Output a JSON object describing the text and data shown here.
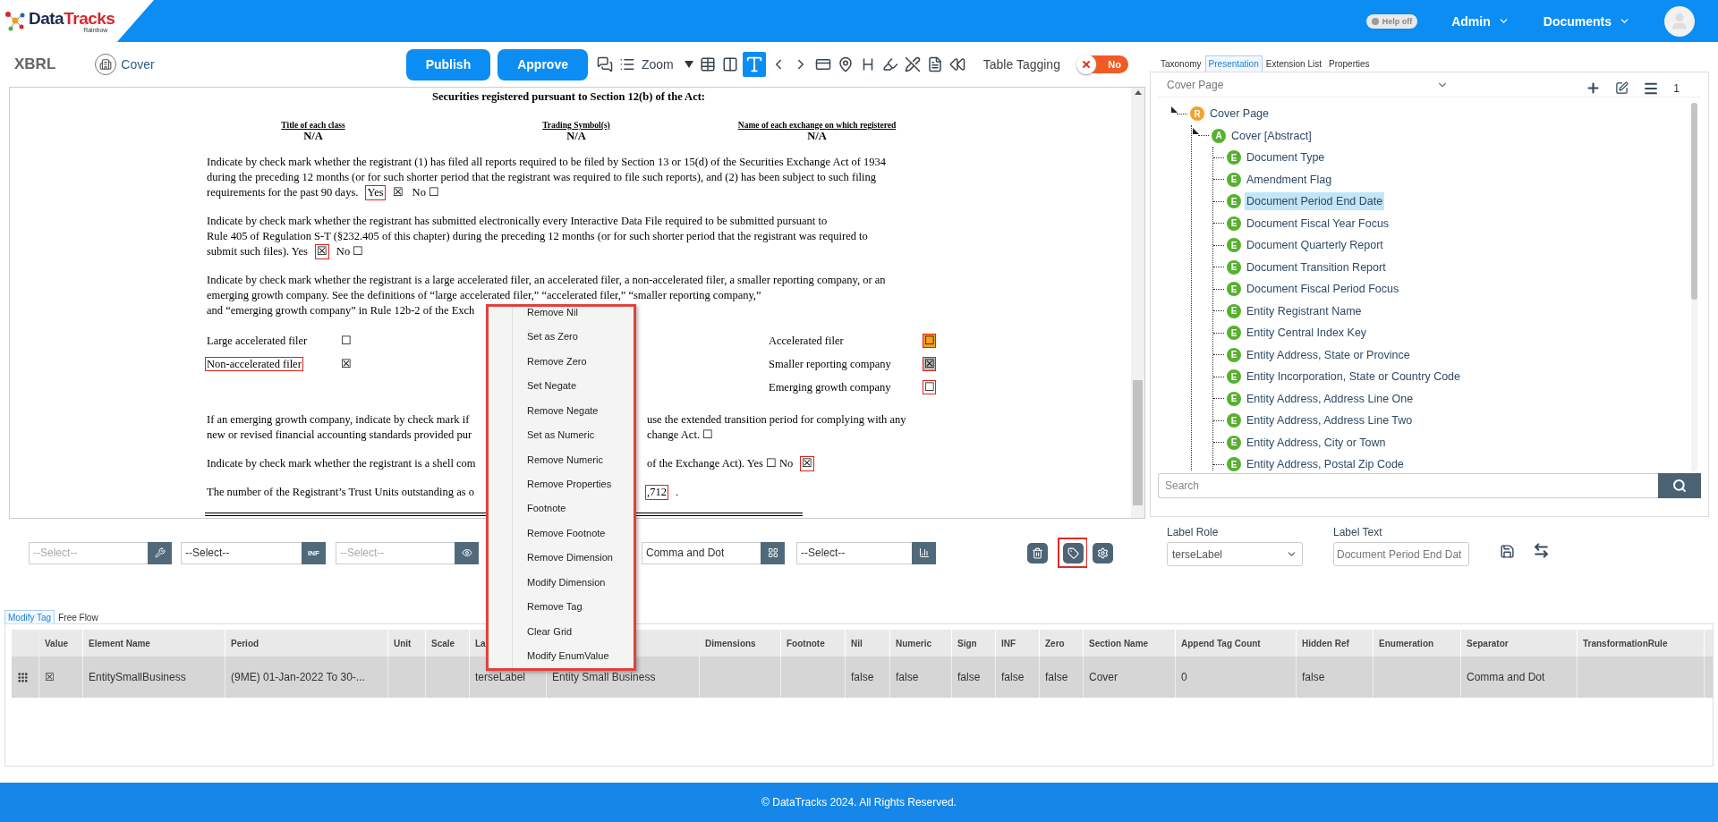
{
  "header": {
    "logo": {
      "brand": "Data",
      "brand_accent": "Tracks",
      "tagline": "Rainbow"
    },
    "help_toggle": {
      "label": "Help off",
      "on": false
    },
    "menus": [
      {
        "label": "Admin"
      },
      {
        "label": "Documents"
      }
    ]
  },
  "toolbar": {
    "title": "XBRL",
    "section": "Cover",
    "buttons": [
      "Publish",
      "Approve"
    ],
    "tools": [
      {
        "kind": "comments",
        "selected": false
      },
      {
        "kind": "list",
        "selected": false
      },
      {
        "kind": "zoom",
        "label": "Zoom",
        "selected": false
      },
      {
        "kind": "table",
        "selected": false
      },
      {
        "kind": "columns",
        "selected": false
      },
      {
        "kind": "text-cursor",
        "selected": true
      },
      {
        "kind": "prev",
        "selected": false
      },
      {
        "kind": "next",
        "selected": false
      },
      {
        "kind": "card",
        "selected": false
      },
      {
        "kind": "pin",
        "selected": false
      },
      {
        "kind": "heading",
        "selected": false
      },
      {
        "kind": "highlight",
        "selected": false
      },
      {
        "kind": "unhighlight",
        "selected": false
      },
      {
        "kind": "document",
        "selected": false
      },
      {
        "kind": "rewind",
        "selected": false
      }
    ],
    "table_tagging": {
      "label": "Table Tagging",
      "on": false,
      "state_label": "No"
    }
  },
  "document": {
    "heading": "Securities registered pursuant to Section 12(b) of the Act:",
    "securities_table": [
      {
        "header": "Title of each class",
        "value": "N/A"
      },
      {
        "header": "Trading Symbol(s)",
        "value": "N/A"
      },
      {
        "header": "Name of each exchange on which registered",
        "value": "N/A"
      }
    ],
    "paragraphs_top": [
      {
        "lines": [
          {
            "left": [
              {
                "text": "Indicate by check mark whether the registrant (1) has filed all reports required to be filed by Section 13 or 15(d) of the Securities Exchange Act of 1934",
                "tagged": false
              }
            ]
          },
          {
            "left": [
              {
                "text": "during the preceding 12 months (or for such shorter period that the registrant was required to file such reports), and (2) has been subject to such filing",
                "tagged": false
              }
            ]
          },
          {
            "left": [
              {
                "text": "requirements for the past 90 days.",
                "tagged": false
              },
              {
                "text": "Yes",
                "tagged": true
              },
              {
                "text": "☒",
                "tagged": false
              },
              {
                "text": "No ☐",
                "tagged": false
              }
            ]
          }
        ]
      },
      {
        "lines": [
          {
            "left": [
              {
                "text": "Indicate by check mark whether the registrant has submitted electronically every Interactive Data File required to be submitted pursuant to",
                "tagged": false
              }
            ]
          },
          {
            "left": [
              {
                "text": "Rule 405 of Regulation S-T (§232.405 of this chapter) during the preceding 12 months (or for such shorter period that the registrant was required to",
                "tagged": false
              }
            ]
          },
          {
            "left": [
              {
                "text": "submit such files).   Yes",
                "tagged": false
              },
              {
                "text": "☒",
                "tagged": true
              },
              {
                "text": "No ☐",
                "tagged": false
              }
            ]
          }
        ]
      },
      {
        "lines": [
          {
            "left": [
              {
                "text": "Indicate by check mark whether the registrant is a large accelerated filer, an accelerated filer, a non-accelerated filer, a smaller reporting company, or an",
                "tagged": false
              }
            ]
          },
          {
            "left": [
              {
                "text": "emerging growth company. See the definitions of “large accelerated filer,” “accelerated filer,” “smaller reporting company,”",
                "tagged": false
              }
            ]
          },
          {
            "left": [
              {
                "text": "and “emerging growth company” in Rule 12b-2 of the Exch",
                "tagged": false
              }
            ]
          }
        ]
      }
    ],
    "filer_left": [
      {
        "label": "Large accelerated filer",
        "label_tagged": false,
        "box": "☐",
        "box_tagged": false
      },
      {
        "label": "Non-accelerated filer",
        "label_tagged": true,
        "box": "☒",
        "box_tagged": false
      }
    ],
    "filer_right": [
      {
        "label": "Accelerated filer",
        "label_tagged": false,
        "box": "☐",
        "box_tagged": true,
        "color": "#f7a01c"
      },
      {
        "label": "Smaller reporting company",
        "label_tagged": false,
        "box": "☒",
        "box_tagged": true,
        "color": "#b9b9b9"
      },
      {
        "label": "Emerging growth company",
        "label_tagged": false,
        "box": "☐",
        "box_tagged": true
      }
    ],
    "paragraphs_bottom": [
      {
        "lines": [
          {
            "left": [
              {
                "text": "If an emerging growth company, indicate by check mark if",
                "tagged": false
              }
            ],
            "right": [
              {
                "text": "use the extended transition period for complying with any",
                "tagged": false
              }
            ]
          },
          {
            "left": [
              {
                "text": "new or revised financial accounting standards provided pur",
                "tagged": false
              }
            ],
            "right": [
              {
                "text": "change Act. ☐",
                "tagged": false
              }
            ]
          }
        ]
      },
      {
        "lines": [
          {
            "left": [
              {
                "text": "Indicate by check mark whether the registrant is a shell com",
                "tagged": false
              }
            ],
            "right": [
              {
                "text": "of the Exchange Act).   Yes ☐   No",
                "tagged": false
              },
              {
                "text": "☒",
                "tagged": true
              }
            ]
          }
        ]
      },
      {
        "lines": [
          {
            "left": [
              {
                "text": "The number of the Registrant’s Trust Units outstanding as o",
                "tagged": false
              }
            ],
            "right": [
              {
                "text": ",712",
                "tagged": true
              },
              {
                "text": ".",
                "tagged": false
              }
            ]
          }
        ]
      }
    ]
  },
  "context_menu": [
    "Remove Nil",
    "Set as Zero",
    "Remove Zero",
    "Set Negate",
    "Remove Negate",
    "Set as Numeric",
    "Remove Numeric",
    "Remove Properties",
    "Footnote",
    "Remove Footnote",
    "Remove Dimension",
    "Modify Dimension",
    "Remove Tag",
    "Clear Grid",
    "Modify EnumValue"
  ],
  "tag_controls": [
    {
      "value": "--Select--",
      "disabled": true
    },
    {
      "value": "--Select--",
      "disabled": false,
      "button_label": "INF"
    },
    {
      "value": "--Select--",
      "disabled": true
    },
    {
      "value": "Comma and Dot",
      "disabled": false
    },
    {
      "value": "--Select--",
      "disabled": false
    }
  ],
  "tag_actions": [
    {
      "selected": false
    },
    {
      "selected": true
    },
    {
      "selected": false
    }
  ],
  "side_panel": {
    "tabs": [
      {
        "label": "Taxonomy",
        "selected": false
      },
      {
        "label": "Presentation",
        "selected": true
      },
      {
        "label": "Extension List",
        "selected": false
      },
      {
        "label": "Properties",
        "selected": false
      }
    ],
    "role_select": "Cover Page",
    "count": "1",
    "tree": [
      {
        "label": "Cover Page",
        "badge": "R",
        "color": "#f5a02a",
        "expanded": true,
        "selected": false,
        "children": [
          {
            "label": "Cover [Abstract]",
            "badge": "A",
            "color": "#58b030",
            "expanded": true,
            "selected": false,
            "children": [
              {
                "label": "Document Type",
                "badge": "E",
                "color": "#58b030",
                "selected": false
              },
              {
                "label": "Amendment Flag",
                "badge": "E",
                "color": "#58b030",
                "selected": false
              },
              {
                "label": "Document Period End Date",
                "badge": "E",
                "color": "#58b030",
                "selected": true
              },
              {
                "label": "Document Fiscal Year Focus",
                "badge": "E",
                "color": "#58b030",
                "selected": false
              },
              {
                "label": "Document Quarterly Report",
                "badge": "E",
                "color": "#58b030",
                "selected": false
              },
              {
                "label": "Document Transition Report",
                "badge": "E",
                "color": "#58b030",
                "selected": false
              },
              {
                "label": "Document Fiscal Period Focus",
                "badge": "E",
                "color": "#58b030",
                "selected": false
              },
              {
                "label": "Entity Registrant Name",
                "badge": "E",
                "color": "#58b030",
                "selected": false
              },
              {
                "label": "Entity Central Index Key",
                "badge": "E",
                "color": "#58b030",
                "selected": false
              },
              {
                "label": "Entity Address, State or Province",
                "badge": "E",
                "color": "#58b030",
                "selected": false
              },
              {
                "label": "Entity Incorporation, State or Country Code",
                "badge": "E",
                "color": "#58b030",
                "selected": false
              },
              {
                "label": "Entity Address, Address Line One",
                "badge": "E",
                "color": "#58b030",
                "selected": false
              },
              {
                "label": "Entity Address, Address Line Two",
                "badge": "E",
                "color": "#58b030",
                "selected": false
              },
              {
                "label": "Entity Address, City or Town",
                "badge": "E",
                "color": "#58b030",
                "selected": false
              },
              {
                "label": "Entity Address, Postal Zip Code",
                "badge": "E",
                "color": "#58b030",
                "selected": false
              }
            ]
          }
        ]
      }
    ],
    "search": {
      "placeholder": "Search"
    },
    "label_role": {
      "label": "Label Role",
      "value": "terseLabel"
    },
    "label_text": {
      "label": "Label Text",
      "value": "Document Period End Dat"
    }
  },
  "bottom_tabs": [
    {
      "label": "Modify Tag",
      "selected": true
    },
    {
      "label": "Free Flow",
      "selected": false
    }
  ],
  "grid": {
    "columns": [
      {
        "label": "Value"
      },
      {
        "label": "Element Name"
      },
      {
        "label": "Period"
      },
      {
        "label": "Unit"
      },
      {
        "label": "Scale"
      },
      {
        "label": "La"
      },
      {},
      {
        "label": "Dimensions"
      },
      {
        "label": "Footnote"
      },
      {
        "label": "Nil"
      },
      {
        "label": "Numeric"
      },
      {
        "label": "Sign"
      },
      {
        "label": "INF"
      },
      {
        "label": "Zero"
      },
      {
        "label": "Section Name"
      },
      {
        "label": "Append Tag Count"
      },
      {
        "label": "Hidden Ref"
      },
      {
        "label": "Enumeration"
      },
      {
        "label": "Separator"
      },
      {
        "label": "TransformationRule"
      }
    ],
    "rows": [
      {
        "selected": true,
        "cells": [
          "☒",
          "EntitySmallBusiness",
          "(9ME) 01-Jan-2022 To 30-...",
          null,
          null,
          "terseLabel",
          "Entity Small Business",
          null,
          null,
          "false",
          "false",
          "false",
          "false",
          "false",
          "Cover",
          "0",
          "false",
          null,
          "Comma and Dot",
          null
        ]
      }
    ]
  },
  "footer": "© DataTracks 2024. All Rights Reserved."
}
